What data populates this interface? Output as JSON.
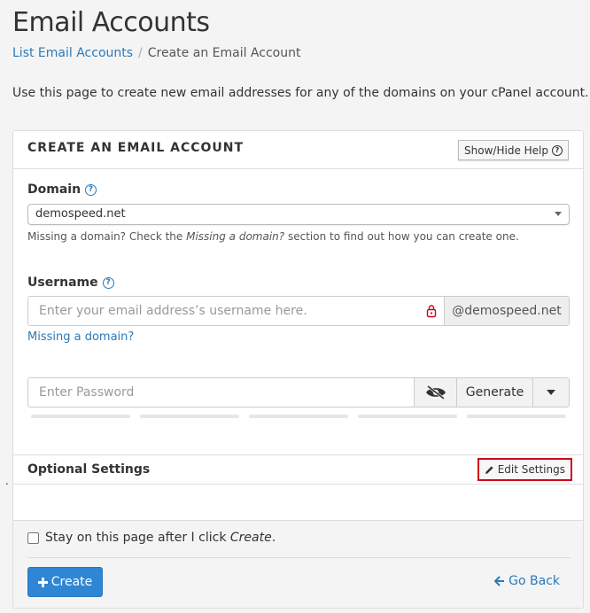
{
  "page": {
    "title": "Email Accounts",
    "breadcrumb": {
      "parent": "List Email Accounts",
      "separator": "/",
      "current": "Create an Email Account"
    },
    "intro": "Use this page to create new email addresses for any of the domains on your cPanel account. Want to"
  },
  "panel": {
    "title": "CREATE AN EMAIL ACCOUNT",
    "help_button": "Show/Hide Help",
    "domain": {
      "label": "Domain",
      "selected": "demospeed.net",
      "hint_prefix": "Missing a domain? Check the ",
      "hint_em": "Missing a domain?",
      "hint_suffix": " section to find out how you can create one."
    },
    "username": {
      "label": "Username",
      "placeholder": "Enter your email address’s username here.",
      "domain_addon": "@demospeed.net",
      "missing_link": "Missing a domain?"
    },
    "password": {
      "placeholder": "Enter Password",
      "generate_label": "Generate"
    },
    "optional": {
      "title": "Optional Settings",
      "edit_button": "Edit Settings"
    },
    "footer": {
      "checkbox_prefix": "Stay on this page after I click ",
      "checkbox_em": "Create",
      "checkbox_suffix": ".",
      "create_button": "Create",
      "go_back": "Go Back"
    }
  },
  "colors": {
    "accent": "#2f86d4",
    "link": "#2a7ab8",
    "highlight": "#d0021b"
  },
  "stray_dot": "."
}
